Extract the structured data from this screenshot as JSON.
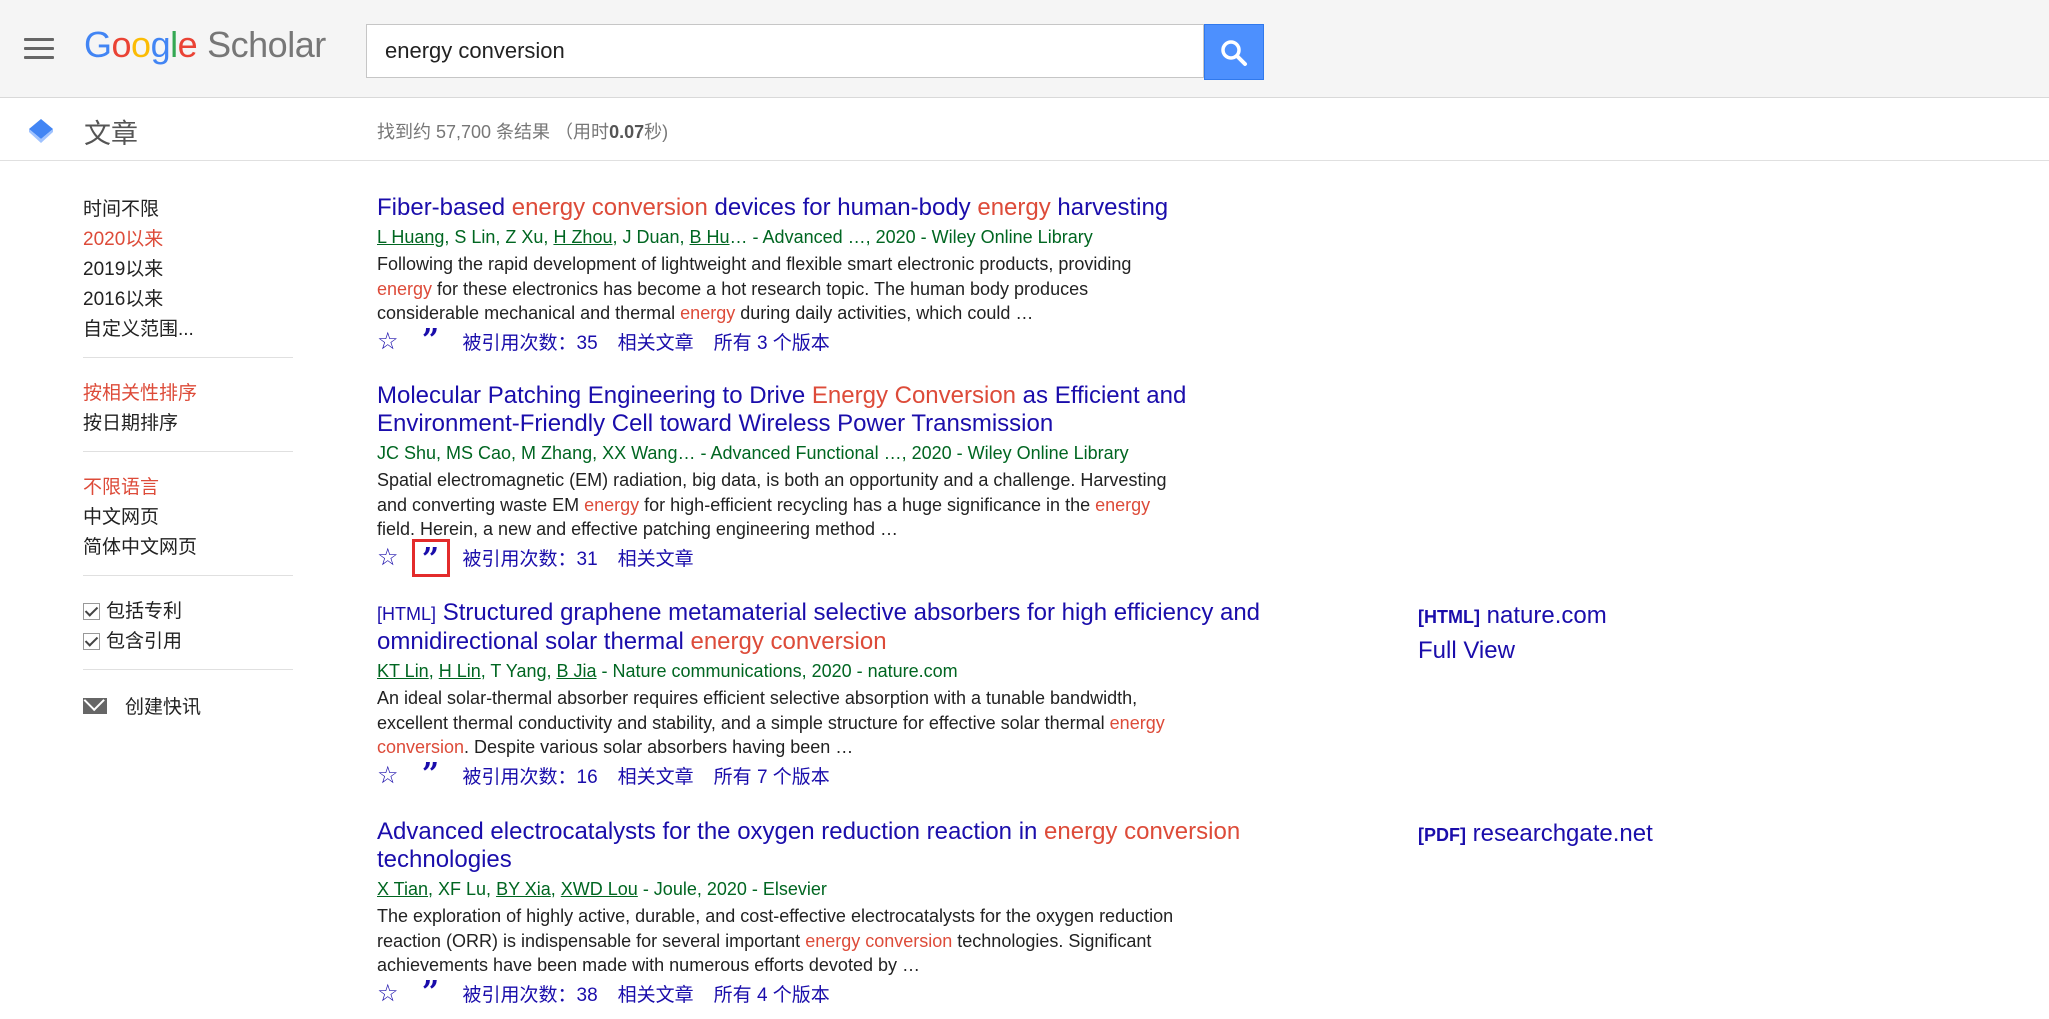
{
  "header": {
    "logo_google": [
      "G",
      "o",
      "o",
      "g",
      "l",
      "e"
    ],
    "logo_scholar": "Scholar",
    "search_value": "energy conversion"
  },
  "subheader": {
    "section_label": "文章",
    "stats_prefix": "找到约 57,700 条结果 （用时",
    "stats_time": "0.07",
    "stats_suffix": "秒)"
  },
  "sidebar": {
    "time_filters": [
      "时间不限",
      "2020以来",
      "2019以来",
      "2016以来",
      "自定义范围..."
    ],
    "time_selected": "2020以来",
    "sort_options": [
      "按相关性排序",
      "按日期排序"
    ],
    "sort_selected": "按相关性排序",
    "language_options": [
      "不限语言",
      "中文网页",
      "简体中文网页"
    ],
    "language_selected": "不限语言",
    "include_patents": "包括专利",
    "include_citations": "包含引用",
    "create_alert": "创建快讯"
  },
  "results": [
    {
      "title_parts": [
        [
          "Fiber-based ",
          false
        ],
        [
          "energy conversion",
          true
        ],
        [
          " devices for human-body ",
          false
        ],
        [
          "energy",
          true
        ],
        [
          " harvesting",
          false
        ]
      ],
      "authors": [
        [
          "L Huang",
          true
        ],
        [
          ", S Lin, Z Xu, ",
          false
        ],
        [
          "H Zhou",
          true
        ],
        [
          ", J Duan, ",
          false
        ],
        [
          "B Hu",
          true
        ],
        [
          "… - Advanced …, 2020 - Wiley Online Library",
          false
        ]
      ],
      "snippet": [
        [
          "Following the rapid development of lightweight and flexible smart electronic products, providing ",
          false
        ],
        [
          "energy",
          true
        ],
        [
          " for these electronics has become a hot research topic. The human body produces considerable mechanical and thermal ",
          false
        ],
        [
          "energy",
          true
        ],
        [
          " during daily activities, which could …",
          false
        ]
      ],
      "cited_by": "被引用次数：35",
      "related": "相关文章",
      "versions": "所有 3 个版本"
    },
    {
      "title_parts": [
        [
          "Molecular Patching Engineering to Drive ",
          false
        ],
        [
          "Energy Conversion",
          true
        ],
        [
          " as Efficient and Environment-Friendly Cell toward Wireless Power Transmission",
          false
        ]
      ],
      "authors": [
        [
          "JC Shu, MS Cao, M Zhang, XX Wang… - Advanced Functional …, 2020 - Wiley Online Library",
          false
        ]
      ],
      "snippet": [
        [
          "Spatial electromagnetic (EM) radiation, big data, is both an opportunity and a challenge. Harvesting and converting waste EM ",
          false
        ],
        [
          "energy",
          true
        ],
        [
          " for high-efficient recycling has a huge significance in the ",
          false
        ],
        [
          "energy",
          true
        ],
        [
          " field. Herein, a new and effective patching engineering method …",
          false
        ]
      ],
      "cited_by": "被引用次数：31",
      "related": "相关文章",
      "versions": ""
    },
    {
      "type_tag": "[HTML]",
      "title_parts": [
        [
          "Structured graphene metamaterial selective absorbers for high efficiency and omnidirectional solar thermal ",
          false
        ],
        [
          "energy conversion",
          true
        ]
      ],
      "authors": [
        [
          "KT Lin",
          true
        ],
        [
          ", ",
          false
        ],
        [
          "H Lin",
          true
        ],
        [
          ", T Yang, ",
          false
        ],
        [
          "B Jia",
          true
        ],
        [
          " - Nature communications, 2020 - nature.com",
          false
        ]
      ],
      "snippet": [
        [
          "An ideal solar-thermal absorber requires efficient selective absorption with a tunable bandwidth, excellent thermal conductivity and stability, and a simple structure for effective solar thermal ",
          false
        ],
        [
          "energy conversion",
          true
        ],
        [
          ". Despite various solar absorbers having been …",
          false
        ]
      ],
      "cited_by": "被引用次数：16",
      "related": "相关文章",
      "versions": "所有 7 个版本",
      "side_tag": "[HTML]",
      "side_site": "nature.com",
      "side_extra": "Full View"
    },
    {
      "title_parts": [
        [
          "Advanced electrocatalysts for the oxygen reduction reaction in ",
          false
        ],
        [
          "energy conversion",
          true
        ],
        [
          " technologies",
          false
        ]
      ],
      "authors": [
        [
          "X Tian",
          true
        ],
        [
          ", XF Lu, ",
          false
        ],
        [
          "BY Xia",
          true
        ],
        [
          ", ",
          false
        ],
        [
          "XWD Lou",
          true
        ],
        [
          " - Joule, 2020 - Elsevier",
          false
        ]
      ],
      "snippet": [
        [
          "The exploration of highly active, durable, and cost-effective electrocatalysts for the oxygen reduction reaction (ORR) is indispensable for several important ",
          false
        ],
        [
          "energy conversion",
          true
        ],
        [
          " technologies. Significant achievements have been made with numerous efforts devoted by …",
          false
        ]
      ],
      "cited_by": "被引用次数：38",
      "related": "相关文章",
      "versions": "所有 4 个版本",
      "side_tag": "[PDF]",
      "side_site": "researchgate.net"
    }
  ],
  "icons": {
    "star": "☆",
    "cite": "”",
    "search": "search-icon",
    "menu": "menu-icon"
  },
  "colors": {
    "link": "#1a0dab",
    "highlight": "#dd4b39",
    "green": "#006621",
    "search_button": "#4d90fe",
    "cite_box": "#e32b2b"
  }
}
